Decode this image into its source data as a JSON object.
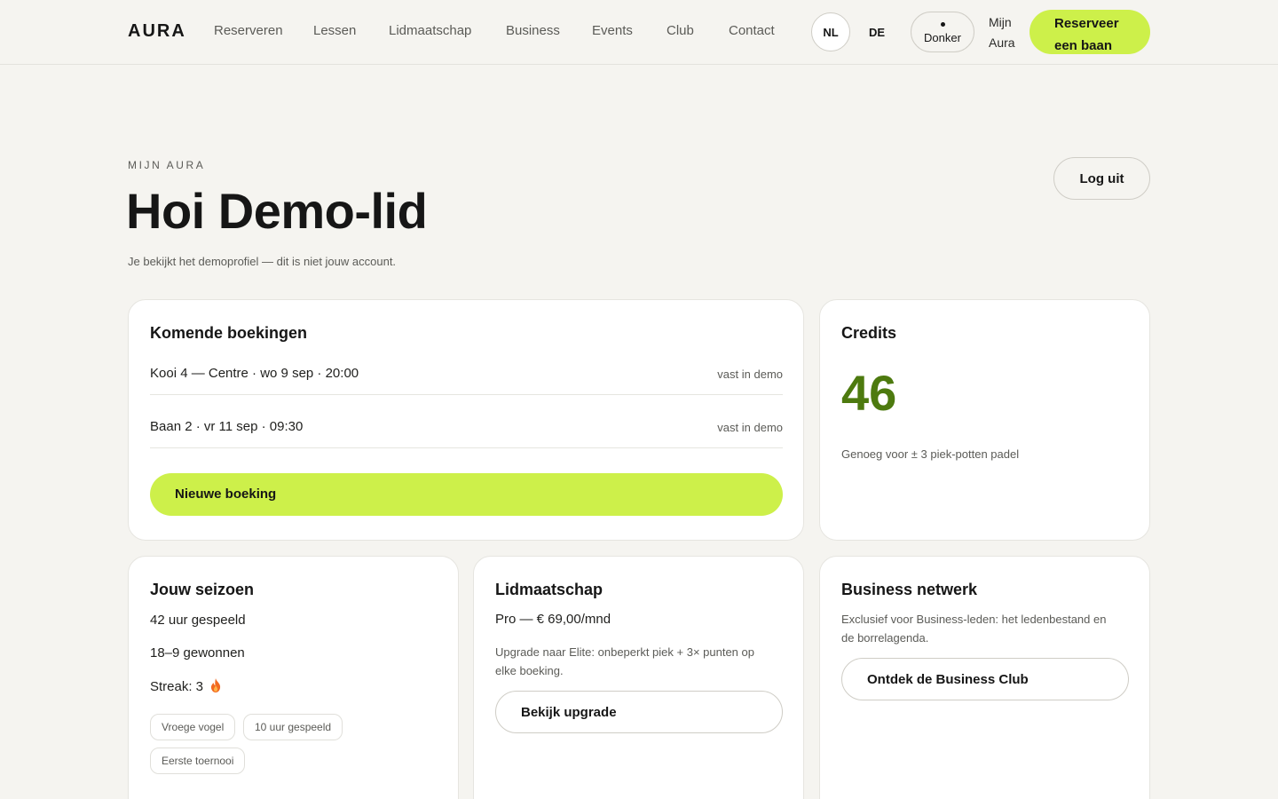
{
  "header": {
    "logo": "AURA",
    "nav": [
      "Reserveren",
      "Lessen",
      "Lidmaatschap",
      "Business",
      "Events",
      "Club",
      "Contact"
    ],
    "languages": [
      {
        "code": "NL",
        "active": true
      },
      {
        "code": "DE",
        "active": false
      }
    ],
    "theme_label": "Donker",
    "account_line1": "Mijn",
    "account_line2": "Aura",
    "cta_line1": "Reserveer",
    "cta_line2": "een baan"
  },
  "hero": {
    "eyebrow": "MIJN AURA",
    "title": "Hoi Demo-lid",
    "subtitle": "Je bekijkt het demoprofiel — dit is niet jouw account.",
    "logout_label": "Log uit"
  },
  "bookings": {
    "title": "Komende boekingen",
    "items": [
      {
        "text": "Kooi 4 — Centre · wo 9 sep · 20:00",
        "tag": "vast in demo"
      },
      {
        "text": "Baan 2 · vr 11 sep · 09:30",
        "tag": "vast in demo"
      }
    ],
    "new_label": "Nieuwe boeking"
  },
  "credits": {
    "title": "Credits",
    "value": "46",
    "note": "Genoeg voor ± 3 piek-potten padel"
  },
  "season": {
    "title": "Jouw seizoen",
    "hours": "42 uur gespeeld",
    "record": "18–9 gewonnen",
    "streak": "Streak: 3",
    "badges": [
      "Vroege vogel",
      "10 uur gespeeld",
      "Eerste toernooi"
    ]
  },
  "membership": {
    "title": "Lidmaatschap",
    "plan": "Pro — € 69,00/mnd",
    "upgrade_text_line1": "Upgrade naar Elite: onbeperkt piek + 3× punten op",
    "upgrade_text_line2": "elke boeking.",
    "button_label": "Bekijk upgrade"
  },
  "business": {
    "title": "Business netwerk",
    "text_line1": "Exclusief voor Business-leden: het ledenbestand en",
    "text_line2": "de borrelagenda.",
    "button_label": "Ontdek de Business Club"
  },
  "colors": {
    "accent": "#cdf04a",
    "credits_green": "#4d7a0f",
    "background": "#f5f4f0"
  }
}
